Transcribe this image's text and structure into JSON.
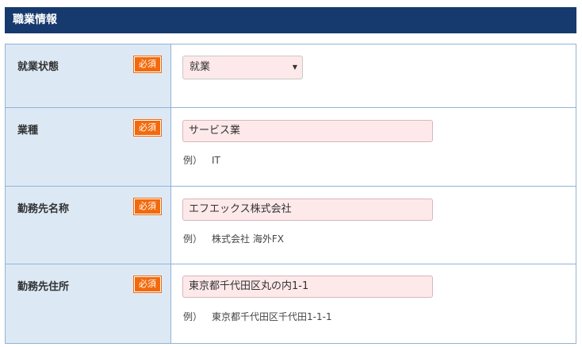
{
  "section": {
    "title": "職業情報"
  },
  "required_label": "必須",
  "example_prefix": "例）",
  "fields": [
    {
      "label": "就業状態",
      "value": "就業",
      "type": "select"
    },
    {
      "label": "業種",
      "value": "サービス業",
      "example": "IT"
    },
    {
      "label": "勤務先名称",
      "value": "エフエックス株式会社",
      "example": "株式会社 海外FX"
    },
    {
      "label": "勤務先住所",
      "value": "東京都千代田区丸の内1-1",
      "example": "東京都千代田区千代田1-1-1"
    }
  ],
  "colors": {
    "header_bg": "#173a6e",
    "label_bg": "#dce9f5",
    "required_badge": "#f26a0c",
    "input_bg": "#fde9ea",
    "border": "#94b3d3"
  }
}
